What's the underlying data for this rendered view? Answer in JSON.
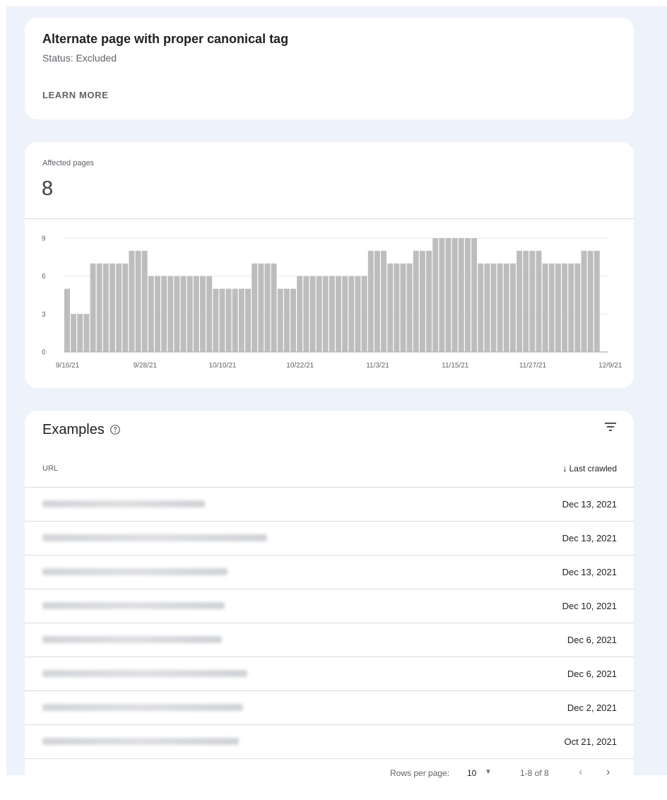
{
  "issue": {
    "title": "Alternate page with proper canonical tag",
    "status": "Status: Excluded",
    "learn_more": "LEARN MORE"
  },
  "affected": {
    "label": "Affected pages",
    "value": "8"
  },
  "chart_data": {
    "type": "bar",
    "ylim": [
      0,
      9
    ],
    "yticks": [
      "0",
      "3",
      "6",
      "9"
    ],
    "xtick_labels": [
      "9/16/21",
      "9/28/21",
      "10/10/21",
      "10/22/21",
      "11/3/21",
      "11/15/21",
      "11/27/21",
      "12/9/21"
    ],
    "grid": true,
    "color": "#bdbdbd",
    "values": [
      5,
      3,
      3,
      3,
      7,
      7,
      7,
      7,
      7,
      7,
      8,
      8,
      8,
      6,
      6,
      6,
      6,
      6,
      6,
      6,
      6,
      6,
      6,
      5,
      5,
      5,
      5,
      5,
      5,
      7,
      7,
      7,
      7,
      5,
      5,
      5,
      6,
      6,
      6,
      6,
      6,
      6,
      6,
      6,
      6,
      6,
      6,
      8,
      8,
      8,
      7,
      7,
      7,
      7,
      8,
      8,
      8,
      9,
      9,
      9,
      9,
      9,
      9,
      9,
      7,
      7,
      7,
      7,
      7,
      7,
      8,
      8,
      8,
      8,
      7,
      7,
      7,
      7,
      7,
      7,
      8,
      8,
      8
    ]
  },
  "examples": {
    "title": "Examples",
    "help_icon": "help-circle-icon",
    "filter_icon": "filter-icon",
    "col_url": "URL",
    "col_crawled": "Last crawled",
    "sort_icon": "arrow-down-icon",
    "rows": [
      {
        "date": "Dec 13, 2021",
        "blur_width": 230
      },
      {
        "date": "Dec 13, 2021",
        "blur_width": 318
      },
      {
        "date": "Dec 13, 2021",
        "blur_width": 262
      },
      {
        "date": "Dec 10, 2021",
        "blur_width": 258
      },
      {
        "date": "Dec 6, 2021",
        "blur_width": 254
      },
      {
        "date": "Dec 6, 2021",
        "blur_width": 290
      },
      {
        "date": "Dec 2, 2021",
        "blur_width": 284
      },
      {
        "date": "Oct 21, 2021",
        "blur_width": 278
      }
    ]
  },
  "pager": {
    "rows_per_page_label": "Rows per page:",
    "rows_per_page_value": "10",
    "range": "1-8 of 8",
    "prev": "‹",
    "next": "›"
  }
}
